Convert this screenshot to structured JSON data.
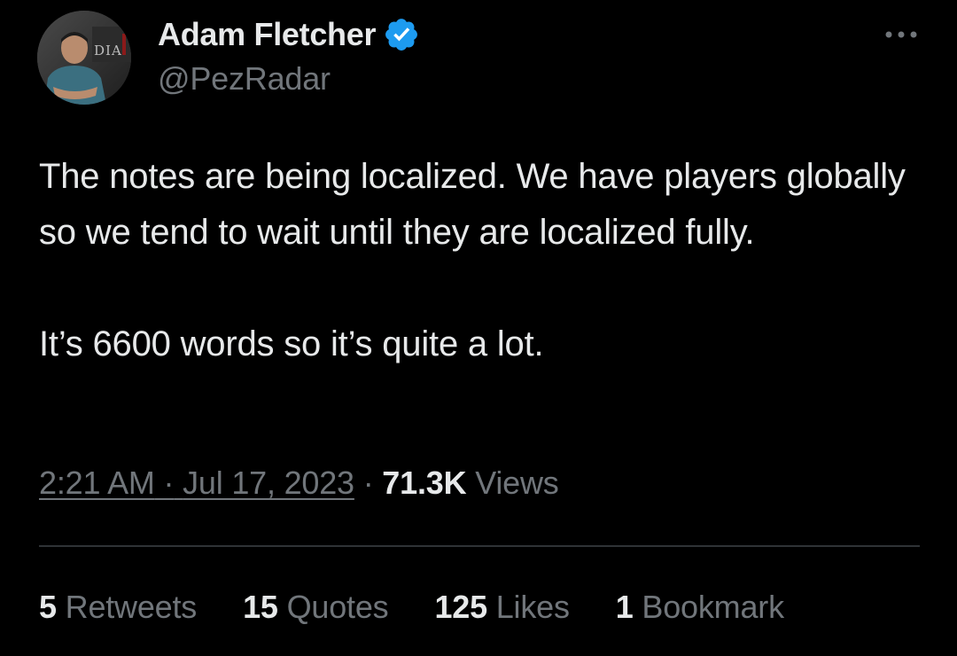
{
  "author": {
    "display_name": "Adam Fletcher",
    "handle": "@PezRadar",
    "verified": true,
    "avatar_banner_text": "DIA"
  },
  "tweet": {
    "paragraphs": [
      "The notes are being localized. We have players globally so we tend to wait until they are localized fully.",
      "It’s 6600 words so it’s quite a lot."
    ]
  },
  "meta": {
    "time": "2:21 AM",
    "separator": "·",
    "date": "Jul 17, 2023",
    "views_count": "71.3K",
    "views_label": "Views"
  },
  "stats": [
    {
      "count": "5",
      "label": "Retweets"
    },
    {
      "count": "15",
      "label": "Quotes"
    },
    {
      "count": "125",
      "label": "Likes"
    },
    {
      "count": "1",
      "label": "Bookmark"
    }
  ],
  "colors": {
    "background": "#000000",
    "text_primary": "#e7e9ea",
    "text_secondary": "#71767b",
    "verified_blue": "#1d9bf0",
    "divider": "#2f3336"
  },
  "icons": {
    "verified": "verified-badge-icon",
    "more": "more-options-icon"
  }
}
